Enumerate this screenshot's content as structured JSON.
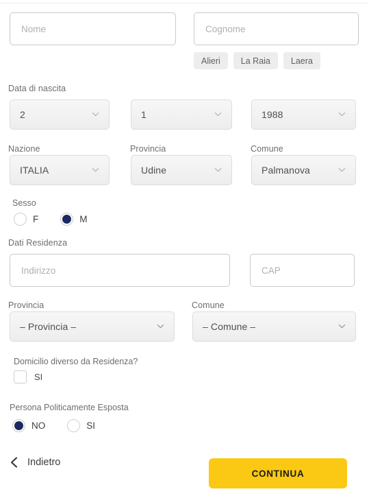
{
  "form": {
    "first_name": {
      "placeholder": "Nome",
      "value": ""
    },
    "last_name": {
      "placeholder": "Cognome",
      "value": ""
    },
    "surname_suggestions": [
      {
        "label": "Alieri"
      },
      {
        "label": "La Raia"
      },
      {
        "label": "Laera"
      }
    ],
    "birth_date": {
      "label": "Data di nascita",
      "day": "2",
      "month": "1",
      "year": "1988"
    },
    "birth_place": {
      "nation_label": "Nazione",
      "nation_value": "ITALIA",
      "province_label": "Provincia",
      "province_value": "Udine",
      "municipality_label": "Comune",
      "municipality_value": "Palmanova"
    },
    "gender": {
      "label": "Sesso",
      "options": [
        {
          "label": "F",
          "selected": false
        },
        {
          "label": "M",
          "selected": true
        }
      ]
    },
    "residence": {
      "section_label": "Dati Residenza",
      "address_placeholder": "Indirizzo",
      "address_value": "",
      "zip_placeholder": "CAP",
      "zip_value": "",
      "province_label": "Provincia",
      "province_value": "– Provincia –",
      "municipality_label": "Comune",
      "municipality_value": "– Comune –"
    },
    "domicile": {
      "question": "Domicilio diverso da Residenza?",
      "checkbox_label": "SI",
      "checked": false
    },
    "pep": {
      "question": "Persona Politicamente Esposta",
      "options": [
        {
          "label": "NO",
          "selected": true
        },
        {
          "label": "SI",
          "selected": false
        }
      ]
    }
  },
  "footer": {
    "back_label": "Indietro",
    "back_icon": "chevron-left-icon",
    "continue_label": "CONTINUA"
  },
  "colors": {
    "accent_yellow": "#FBC913",
    "radio_navy": "#1B2A5E",
    "chip_grey": "#EDEDED",
    "border_grey": "#C9C9C9"
  }
}
